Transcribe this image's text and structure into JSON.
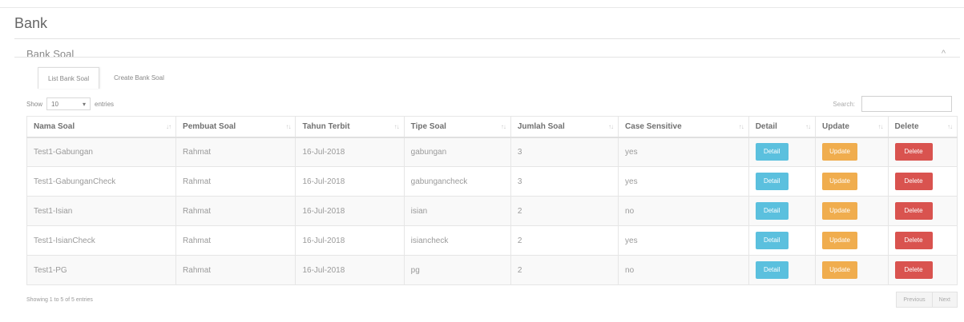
{
  "page": {
    "title": "Bank"
  },
  "box": {
    "title": "Bank Soal",
    "collapse_icon": "^"
  },
  "tabs": [
    {
      "label": "List Bank Soal",
      "active": true
    },
    {
      "label": "Create Bank Soal",
      "active": false
    }
  ],
  "length_control": {
    "prefix": "Show",
    "value": "10",
    "suffix": "entries",
    "caret": "▾"
  },
  "search": {
    "label": "Search:",
    "value": ""
  },
  "table": {
    "columns": [
      "Nama Soal",
      "Pembuat Soal",
      "Tahun Terbit",
      "Tipe Soal",
      "Jumlah Soal",
      "Case Sensitive",
      "Detail",
      "Update",
      "Delete"
    ],
    "sort_icons": [
      "↓↑",
      "↑↓",
      "↑↓",
      "↑↓",
      "↑↓",
      "↑↓",
      "↑↓",
      "↑↓",
      "↑↓"
    ],
    "rows": [
      {
        "nama": "Test1-Gabungan",
        "pembuat": "Rahmat",
        "tahun": "16-Jul-2018",
        "tipe": "gabungan",
        "jumlah": "3",
        "case": "yes"
      },
      {
        "nama": "Test1-GabunganCheck",
        "pembuat": "Rahmat",
        "tahun": "16-Jul-2018",
        "tipe": "gabungancheck",
        "jumlah": "3",
        "case": "yes"
      },
      {
        "nama": "Test1-Isian",
        "pembuat": "Rahmat",
        "tahun": "16-Jul-2018",
        "tipe": "isian",
        "jumlah": "2",
        "case": "no"
      },
      {
        "nama": "Test1-IsianCheck",
        "pembuat": "Rahmat",
        "tahun": "16-Jul-2018",
        "tipe": "isiancheck",
        "jumlah": "2",
        "case": "yes"
      },
      {
        "nama": "Test1-PG",
        "pembuat": "Rahmat",
        "tahun": "16-Jul-2018",
        "tipe": "pg",
        "jumlah": "2",
        "case": "no"
      }
    ],
    "buttons": {
      "detail": "Detail",
      "update": "Update",
      "delete": "Delete"
    }
  },
  "footer": {
    "info": "Showing 1 to 5 of 5 entries",
    "previous": "Previous",
    "next": "Next"
  },
  "colors": {
    "detail": "#5bc0de",
    "update": "#f0ad4e",
    "delete": "#d9534f"
  }
}
